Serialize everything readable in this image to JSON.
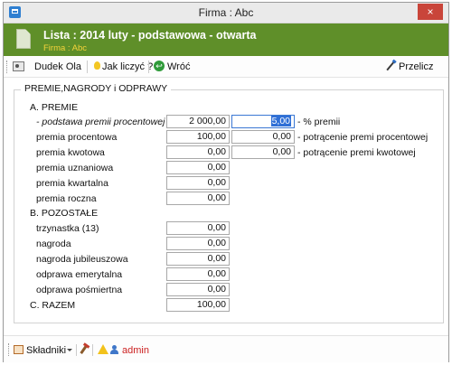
{
  "window": {
    "title": "Firma : Abc",
    "close_glyph": "×"
  },
  "header": {
    "title": "Lista : 2014 luty - podstawowa - otwarta",
    "subtitle": "Firma : Abc",
    "accent": "#5f8f29",
    "subtitle_color": "#f5d33a"
  },
  "toolbar": {
    "employee": "Dudek Ola",
    "how": "Jak liczyć ?",
    "back": "Wróć",
    "recalc": "Przelicz"
  },
  "form": {
    "legend": "PREMIE,NAGRODY i ODPRAWY",
    "section_a": "A. PREMIE",
    "basis_label": "- podstawa premii procentowej",
    "basis_value": "2 000,00",
    "rows_a": [
      {
        "label": "premia procentowa",
        "value": "100,00"
      },
      {
        "label": "premia kwotowa",
        "value": "0,00"
      },
      {
        "label": "premia uznaniowa",
        "value": "0,00"
      },
      {
        "label": "premia kwartalna",
        "value": "0,00"
      },
      {
        "label": "premia roczna",
        "value": "0,00"
      }
    ],
    "percent_value": "5,00",
    "percent_label": "- % premii",
    "deduct_pct_value": "0,00",
    "deduct_pct_label": "- potrącenie premi procentowej",
    "deduct_amt_value": "0,00",
    "deduct_amt_label": "- potrącenie premi kwotowej",
    "section_b": "B. POZOSTAŁE",
    "rows_b": [
      {
        "label": "trzynastka  (13)",
        "value": "0,00"
      },
      {
        "label": "nagroda",
        "value": "0,00"
      },
      {
        "label": "nagroda jubileuszowa",
        "value": "0,00"
      },
      {
        "label": "odprawa emerytalna",
        "value": "0,00"
      },
      {
        "label": "odprawa pośmiertna",
        "value": "0,00"
      }
    ],
    "section_c": "C. RAZEM",
    "total": "100,00"
  },
  "statusbar": {
    "components": "Składniki",
    "user": "admin"
  },
  "icons": [
    "app-icon",
    "close-icon",
    "document-icon",
    "person-card-icon",
    "lightbulb-icon",
    "back-arrow-icon",
    "pen-icon",
    "components-icon",
    "tool-icon",
    "warning-icon",
    "user-icon"
  ]
}
